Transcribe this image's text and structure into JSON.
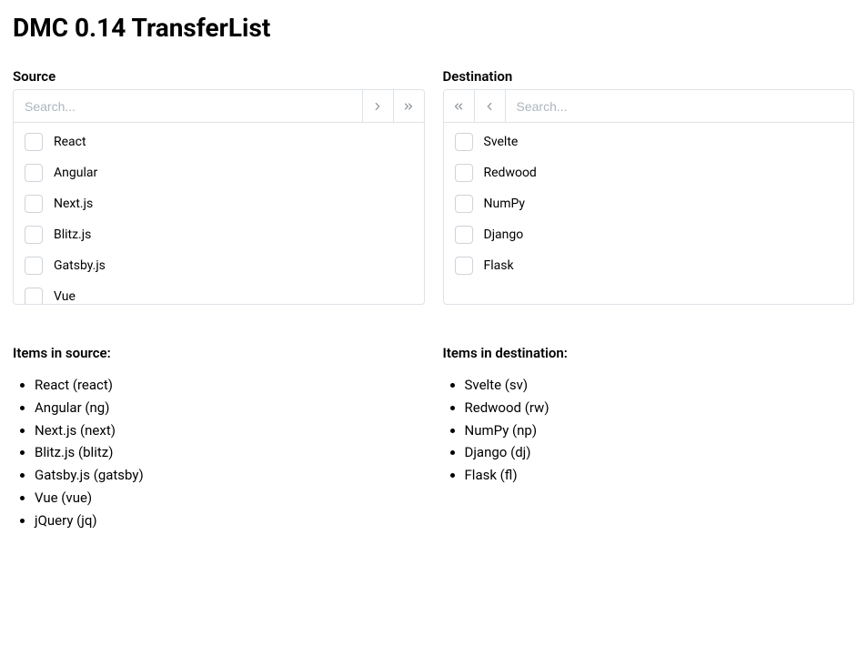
{
  "title": "DMC 0.14 TransferList",
  "source": {
    "title": "Source",
    "search_placeholder": "Search...",
    "items": [
      {
        "label": "React",
        "value": "react"
      },
      {
        "label": "Angular",
        "value": "ng"
      },
      {
        "label": "Next.js",
        "value": "next"
      },
      {
        "label": "Blitz.js",
        "value": "blitz"
      },
      {
        "label": "Gatsby.js",
        "value": "gatsby"
      },
      {
        "label": "Vue",
        "value": "vue"
      },
      {
        "label": "jQuery",
        "value": "jq"
      }
    ],
    "summary_title": "Items in source:"
  },
  "destination": {
    "title": "Destination",
    "search_placeholder": "Search...",
    "items": [
      {
        "label": "Svelte",
        "value": "sv"
      },
      {
        "label": "Redwood",
        "value": "rw"
      },
      {
        "label": "NumPy",
        "value": "np"
      },
      {
        "label": "Django",
        "value": "dj"
      },
      {
        "label": "Flask",
        "value": "fl"
      }
    ],
    "summary_title": "Items in destination:"
  }
}
